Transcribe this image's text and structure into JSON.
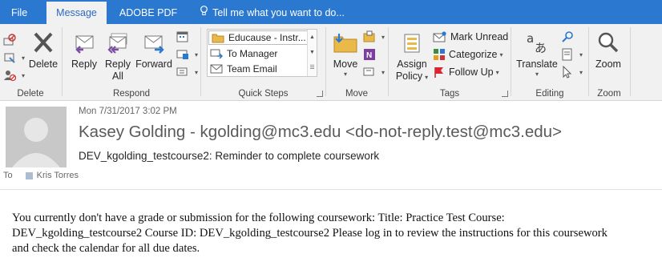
{
  "tabs": {
    "file": "File",
    "message": "Message",
    "adobe": "ADOBE PDF",
    "tell_me": "Tell me what you want to do..."
  },
  "ribbon": {
    "delete_group": {
      "label": "Delete",
      "delete": "Delete"
    },
    "respond_group": {
      "label": "Respond",
      "reply": "Reply",
      "reply_all_1": "Reply",
      "reply_all_2": "All",
      "forward": "Forward"
    },
    "quick_steps": {
      "label": "Quick Steps",
      "items": [
        "Educause - Instr...",
        "To Manager",
        "Team Email"
      ]
    },
    "move_group": {
      "label": "Move",
      "move": "Move"
    },
    "tags_group": {
      "label": "Tags",
      "assign_1": "Assign",
      "assign_2": "Policy",
      "mark_unread": "Mark Unread",
      "categorize": "Categorize",
      "follow_up": "Follow Up"
    },
    "editing_group": {
      "label": "Editing",
      "translate": "Translate"
    },
    "zoom_group": {
      "label": "Zoom",
      "zoom": "Zoom"
    }
  },
  "message": {
    "date": "Mon 7/31/2017 3:02 PM",
    "sender": "Kasey Golding - kgolding@mc3.edu <do-not-reply.test@mc3.edu>",
    "subject": "DEV_kgolding_testcourse2: Reminder to complete coursework",
    "to_label": "To",
    "to_name": "Kris Torres",
    "body_lines": [
      "You currently don't have a grade or submission for the following coursework: Title: Practice Test Course:",
      "DEV_kgolding_testcourse2 Course ID: DEV_kgolding_testcourse2 Please log in to review the instructions for this coursework",
      "and check the calendar for all due dates."
    ]
  },
  "colors": {
    "tab_bar": "#2b78d1",
    "ribbon_bg": "#f1f1f1",
    "accent_purple": "#7b4ea3",
    "accent_blue": "#2b78d1"
  }
}
